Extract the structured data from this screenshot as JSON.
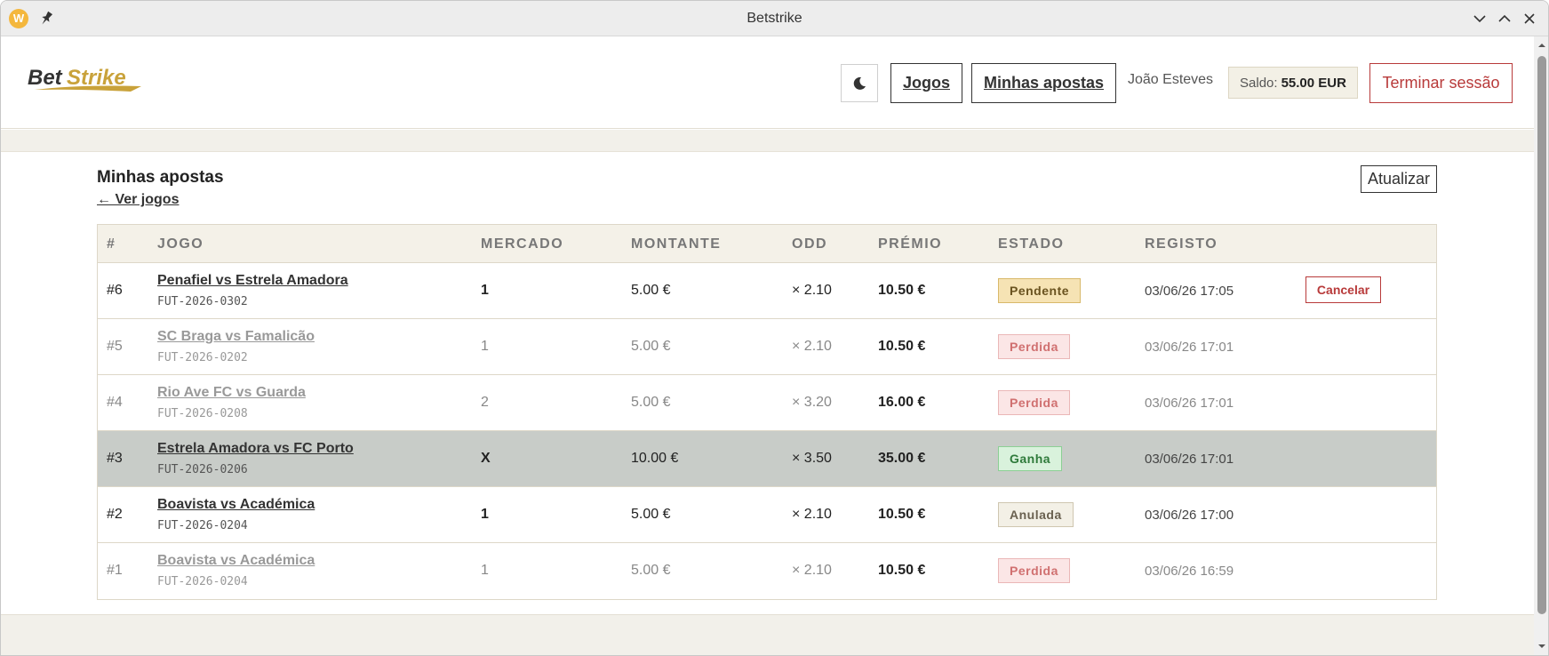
{
  "window": {
    "title": "Betstrike"
  },
  "header": {
    "logo_text": "BetStrike",
    "nav": {
      "jogos": "Jogos",
      "minhas_apostas": "Minhas apostas"
    },
    "user_name": "João Esteves",
    "saldo_label": "Saldo:",
    "saldo_value": "55.00 EUR",
    "logout": "Terminar sessão"
  },
  "page": {
    "title": "Minhas apostas",
    "back_link": "← Ver jogos",
    "refresh": "Atualizar"
  },
  "table": {
    "headers": [
      "#",
      "JOGO",
      "MERCADO",
      "MONTANTE",
      "ODD",
      "PRÉMIO",
      "ESTADO",
      "REGISTO"
    ],
    "cancel_label": "Cancelar",
    "rows": [
      {
        "id": "#6",
        "game": "Penafiel vs Estrela Amadora",
        "code": "FUT-2026-0302",
        "market": "1",
        "amount": "5.00 €",
        "odd": "× 2.10",
        "prize": "10.50 €",
        "status": "Pendente",
        "registered": "03/06/26 17:05"
      },
      {
        "id": "#5",
        "game": "SC Braga vs Famalicão",
        "code": "FUT-2026-0202",
        "market": "1",
        "amount": "5.00 €",
        "odd": "× 2.10",
        "prize": "10.50 €",
        "status": "Perdida",
        "registered": "03/06/26 17:01"
      },
      {
        "id": "#4",
        "game": "Rio Ave FC vs Guarda",
        "code": "FUT-2026-0208",
        "market": "2",
        "amount": "5.00 €",
        "odd": "× 3.20",
        "prize": "16.00 €",
        "status": "Perdida",
        "registered": "03/06/26 17:01"
      },
      {
        "id": "#3",
        "game": "Estrela Amadora vs FC Porto",
        "code": "FUT-2026-0206",
        "market": "X",
        "amount": "10.00 €",
        "odd": "× 3.50",
        "prize": "35.00 €",
        "status": "Ganha",
        "registered": "03/06/26 17:01"
      },
      {
        "id": "#2",
        "game": "Boavista vs Académica",
        "code": "FUT-2026-0204",
        "market": "1",
        "amount": "5.00 €",
        "odd": "× 2.10",
        "prize": "10.50 €",
        "status": "Anulada",
        "registered": "03/06/26 17:00"
      },
      {
        "id": "#1",
        "game": "Boavista vs Académica",
        "code": "FUT-2026-0204",
        "market": "1",
        "amount": "5.00 €",
        "odd": "× 2.10",
        "prize": "10.50 €",
        "status": "Perdida",
        "registered": "03/06/26 16:59"
      }
    ]
  },
  "colors": {
    "accent_gold": "#c9a23a",
    "danger": "#b83a3a",
    "pending": "#f6e3b4",
    "lost": "#fbe6e6",
    "won": "#d9f2dc",
    "void": "#f3f0e6"
  }
}
